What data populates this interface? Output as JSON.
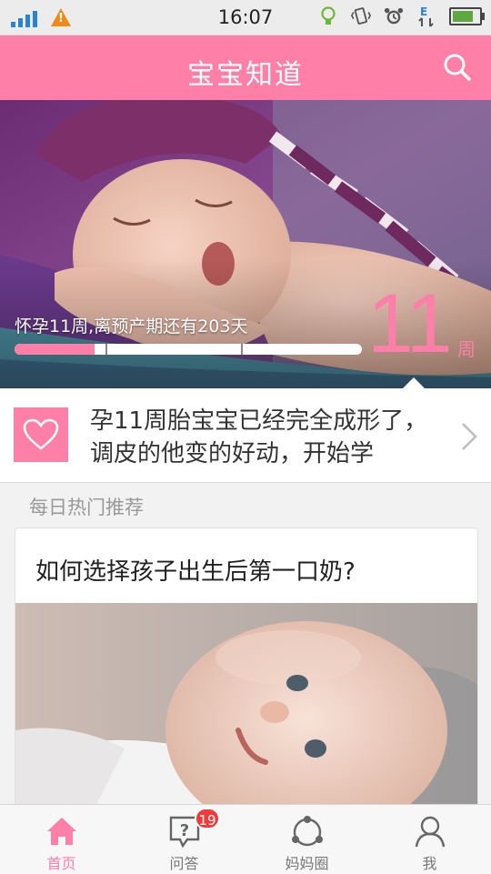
{
  "status_bar": {
    "time": "16:07",
    "warning_glyph": "!"
  },
  "header": {
    "title": "宝宝知道"
  },
  "hero": {
    "pregnancy_text": "怀孕11周,离预产期还有203天",
    "week_number": "11",
    "week_unit": "周",
    "progress_fraction": 0.23
  },
  "tip": {
    "text": "孕11周胎宝宝已经完全成形了，调皮的他变的好动，开始学"
  },
  "daily": {
    "section_title": "每日热门推荐",
    "card_title": "如何选择孩子出生后第一口奶?"
  },
  "bottom_nav": {
    "items": [
      {
        "label": "首页",
        "icon": "home-icon"
      },
      {
        "label": "问答",
        "icon": "question-icon",
        "badge": "19"
      },
      {
        "label": "妈妈圈",
        "icon": "circle-icon"
      },
      {
        "label": "我",
        "icon": "user-icon"
      }
    ]
  },
  "colors": {
    "accent": "#fe7fa7",
    "badge": "#f23a3a"
  }
}
